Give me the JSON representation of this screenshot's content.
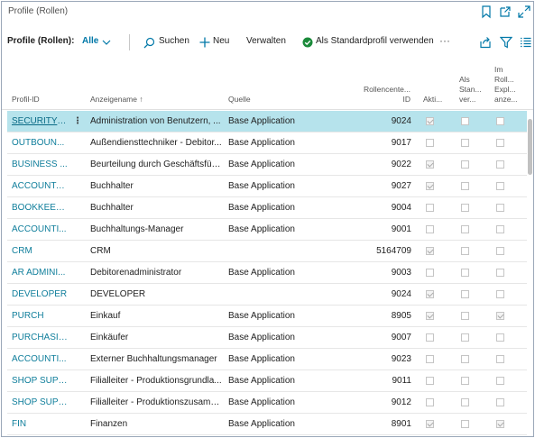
{
  "window": {
    "title": "Profile (Rollen)"
  },
  "actionbar": {
    "label": "Profile (Rollen):",
    "filter": "Alle",
    "search": "Suchen",
    "new": "Neu",
    "manage": "Verwalten",
    "set_default": "Als Standardprofil verwenden",
    "more": "···"
  },
  "columns": {
    "profile_id": "Profil-ID",
    "display_name": "Anzeigename ↑",
    "source": "Quelle",
    "rolecenter_line1": "Rollencente...",
    "rolecenter_line2": "ID",
    "active": "Akti...",
    "standard_line1": "Als",
    "standard_line2": "Stan...",
    "standard_line3": "ver...",
    "explorer_line1": "Im",
    "explorer_line2": "Roll...",
    "explorer_line3": "Expl...",
    "explorer_line4": "anze..."
  },
  "rows": [
    {
      "id": "SECURITY A...",
      "name": "Administration von Benutzern, ...",
      "source": "Base Application",
      "rolecenter": "9024",
      "active": true,
      "standard": false,
      "explorer": false,
      "selected": true
    },
    {
      "id": "OUTBOUN...",
      "name": "Außendiensttechniker - Debitor...",
      "source": "Base Application",
      "rolecenter": "9017",
      "active": false,
      "standard": false,
      "explorer": false
    },
    {
      "id": "BUSINESS ...",
      "name": "Beurteilung durch Geschäftsfüh...",
      "source": "Base Application",
      "rolecenter": "9022",
      "active": true,
      "standard": false,
      "explorer": false
    },
    {
      "id": "ACCOUNTA...",
      "name": "Buchhalter",
      "source": "Base Application",
      "rolecenter": "9027",
      "active": true,
      "standard": false,
      "explorer": false
    },
    {
      "id": "BOOKKEEPER",
      "name": "Buchhalter",
      "source": "Base Application",
      "rolecenter": "9004",
      "active": false,
      "standard": false,
      "explorer": false
    },
    {
      "id": "ACCOUNTI...",
      "name": "Buchhaltungs-Manager",
      "source": "Base Application",
      "rolecenter": "9001",
      "active": false,
      "standard": false,
      "explorer": false
    },
    {
      "id": "CRM",
      "name": "CRM",
      "source": "",
      "rolecenter": "5164709",
      "active": true,
      "standard": false,
      "explorer": false
    },
    {
      "id": "AR ADMINI...",
      "name": "Debitorenadministrator",
      "source": "Base Application",
      "rolecenter": "9003",
      "active": false,
      "standard": false,
      "explorer": false
    },
    {
      "id": "DEVELOPER",
      "name": "DEVELOPER",
      "source": "",
      "rolecenter": "9024",
      "active": true,
      "standard": false,
      "explorer": false
    },
    {
      "id": "PURCH",
      "name": "Einkauf",
      "source": "Base Application",
      "rolecenter": "8905",
      "active": true,
      "standard": false,
      "explorer": true
    },
    {
      "id": "PURCHASIN...",
      "name": "Einkäufer",
      "source": "Base Application",
      "rolecenter": "9007",
      "active": false,
      "standard": false,
      "explorer": false
    },
    {
      "id": "ACCOUNTI...",
      "name": "Externer Buchhaltungsmanager",
      "source": "Base Application",
      "rolecenter": "9023",
      "active": false,
      "standard": false,
      "explorer": false
    },
    {
      "id": "SHOP SUPE...",
      "name": "Filialleiter - Produktionsgrundla...",
      "source": "Base Application",
      "rolecenter": "9011",
      "active": false,
      "standard": false,
      "explorer": false
    },
    {
      "id": "SHOP SUPE...",
      "name": "Filialleiter - Produktionszusamm...",
      "source": "Base Application",
      "rolecenter": "9012",
      "active": false,
      "standard": false,
      "explorer": false
    },
    {
      "id": "FIN",
      "name": "Finanzen",
      "source": "Base Application",
      "rolecenter": "8901",
      "active": true,
      "standard": false,
      "explorer": true
    }
  ],
  "colors": {
    "accent": "#0078a8",
    "link": "#0f7e9b",
    "selected_row": "#b6e3ec",
    "check_green": "#1a8a3a"
  }
}
